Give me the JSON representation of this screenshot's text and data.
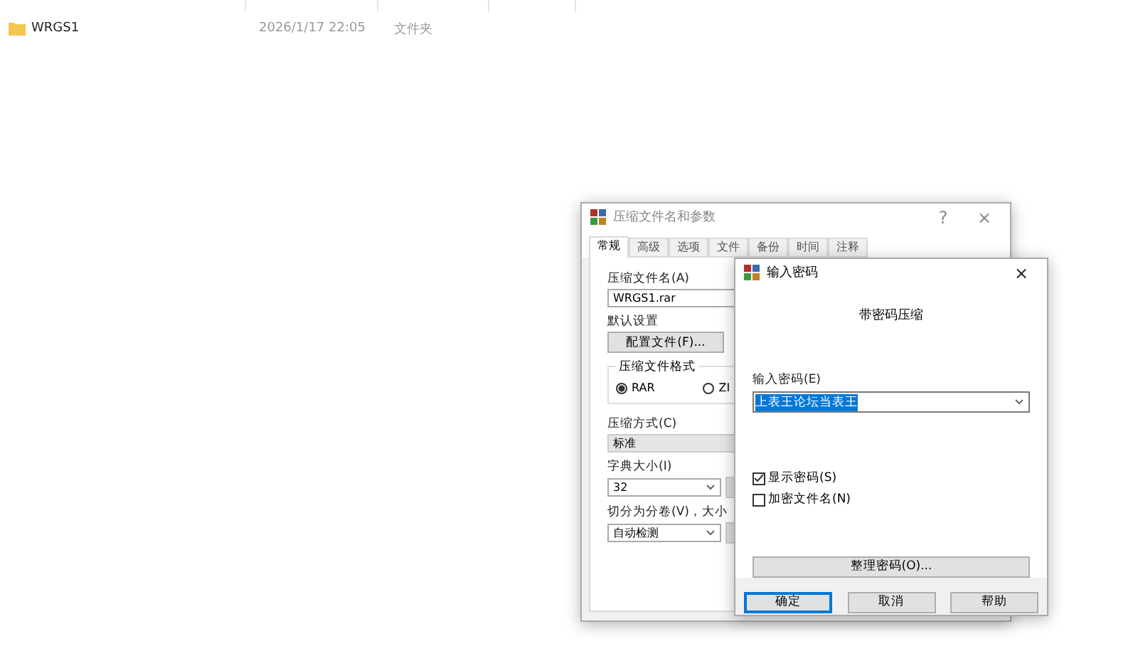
{
  "file_list": {
    "rows": [
      {
        "name": "WRGS1",
        "modified": "2026/1/17 22:05",
        "type": "文件夹"
      }
    ]
  },
  "archive_dialog": {
    "title": "压缩文件名和参数",
    "help_button": "?",
    "close_button": "×",
    "tabs": [
      {
        "label": "常规",
        "selected": true
      },
      {
        "label": "高级",
        "selected": false
      },
      {
        "label": "选项",
        "selected": false
      },
      {
        "label": "文件",
        "selected": false
      },
      {
        "label": "备份",
        "selected": false
      },
      {
        "label": "时间",
        "selected": false
      },
      {
        "label": "注释",
        "selected": false
      }
    ],
    "archive_name_label": "压缩文件名(A)",
    "archive_name": "WRGS1.rar",
    "defaults_label": "默认设置",
    "profiles_button": "配置文件(F)...",
    "format_group": {
      "title": "压缩文件格式",
      "options": [
        {
          "label": "RAR",
          "selected": true
        },
        {
          "label": "ZI",
          "selected": false
        }
      ]
    },
    "method_label": "压缩方式(C)",
    "method": "标准",
    "dictionary_label": "字典大小(I)",
    "dictionary": "32",
    "split_label": "切分为分卷(V)，大小",
    "split": "自动检测"
  },
  "password_dialog": {
    "title": "输入密码",
    "close_button": "×",
    "heading": "带密码压缩",
    "password_label": "输入密码(E)",
    "password": "上表王论坛当表王",
    "options": [
      {
        "label": "显示密码(S)",
        "checked": true
      },
      {
        "label": "加密文件名(N)",
        "checked": false
      }
    ],
    "organize_button": "整理密码(O)...",
    "buttons": [
      {
        "label": "确定",
        "focused": true
      },
      {
        "label": "取消",
        "focused": false
      },
      {
        "label": "帮助",
        "focused": false
      }
    ]
  }
}
